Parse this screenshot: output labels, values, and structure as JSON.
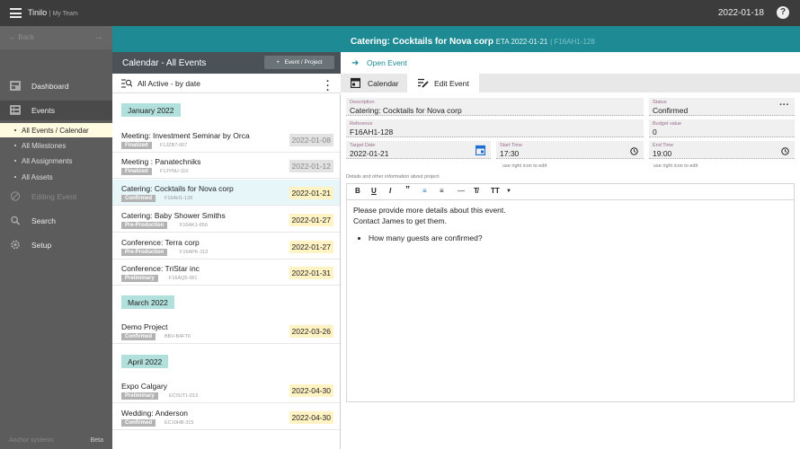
{
  "topbar": {
    "app": "Tinilo",
    "team": "| My Team",
    "date": "2022-01-18",
    "help": "?"
  },
  "band": {
    "event_title": "Catering: Cocktails for Nova corp",
    "eta": "ETA 2022-01-21",
    "eta_extra": "| F16AH1-128"
  },
  "sidebar": {
    "back": "Back",
    "items": [
      {
        "label": "Dashboard"
      },
      {
        "label": "Events"
      },
      {
        "label": "Editing Event"
      },
      {
        "label": "Search"
      },
      {
        "label": "Setup"
      }
    ],
    "sub": [
      {
        "label": "All Events / Calendar"
      },
      {
        "label": "All Milestones"
      },
      {
        "label": "All Assignments"
      },
      {
        "label": "All Assets"
      }
    ],
    "footer": "Anchor systems",
    "beta": "Beta"
  },
  "list": {
    "title": "Calendar - All Events",
    "add_button": "Event / Project",
    "filter": "All Active - by date",
    "months": [
      "January 2022",
      "March 2022",
      "April 2022"
    ],
    "events": [
      {
        "name": "Meeting: Investment Seminar by Orca",
        "status": "Finalized",
        "ref": "F1JZB7-007",
        "date": "2022-01-08"
      },
      {
        "name": "Meeting : Panatechniks",
        "status": "Finalized",
        "ref": "F1JYNU-110",
        "date": "2022-01-12"
      },
      {
        "name": "Catering: Cocktails for Nova corp",
        "status": "Confirmed",
        "ref": "F16AH1-128",
        "date": "2022-01-21"
      },
      {
        "name": "Catering: Baby Shower Smiths",
        "status": "Pre-Production",
        "ref": "F16AK1-650",
        "date": "2022-01-27"
      },
      {
        "name": "Conference: Terra corp",
        "status": "Pre-Production",
        "ref": "F16APK-113",
        "date": "2022-01-27"
      },
      {
        "name": "Conference: TriStar inc",
        "status": "Preliminary",
        "ref": "F16AQ5-061",
        "date": "2022-01-31"
      },
      {
        "name": "Demo Project",
        "status": "Confirmed",
        "ref": "BBV-B4FT6",
        "date": "2022-03-26"
      },
      {
        "name": "Expo Calgary",
        "status": "Preliminary",
        "ref": "EC0UT1-013",
        "date": "2022-04-30"
      },
      {
        "name": "Wedding: Anderson",
        "status": "Confirmed",
        "ref": "EC10HB-315",
        "date": "2022-04-30"
      }
    ]
  },
  "detail": {
    "open_event": "Open Event",
    "tabs": [
      "Calendar",
      "Edit Event"
    ],
    "fields": {
      "description": {
        "label": "Description",
        "value": "Catering: Cocktails for Nova corp"
      },
      "status": {
        "label": "Status",
        "value": "Confirmed"
      },
      "reference": {
        "label": "Reference",
        "value": "F16AH1-128"
      },
      "budget": {
        "label": "Budget value",
        "value": "0"
      },
      "target_date": {
        "label": "Target Date",
        "value": "2022-01-21"
      },
      "start_time": {
        "label": "Start Time",
        "value": "17:30"
      },
      "end_time": {
        "label": "End Time",
        "value": "19:00"
      }
    },
    "hint": "use right icon to edit",
    "details_label": "Details and other information about project",
    "editor": {
      "line1": "Please provide more details about this event.",
      "line2": "Contact James to get them.",
      "bullet": "How many guests are confirmed?"
    },
    "colors": {
      "teal": "#1d8a94",
      "accent_blue": "#1a6fd1"
    }
  }
}
